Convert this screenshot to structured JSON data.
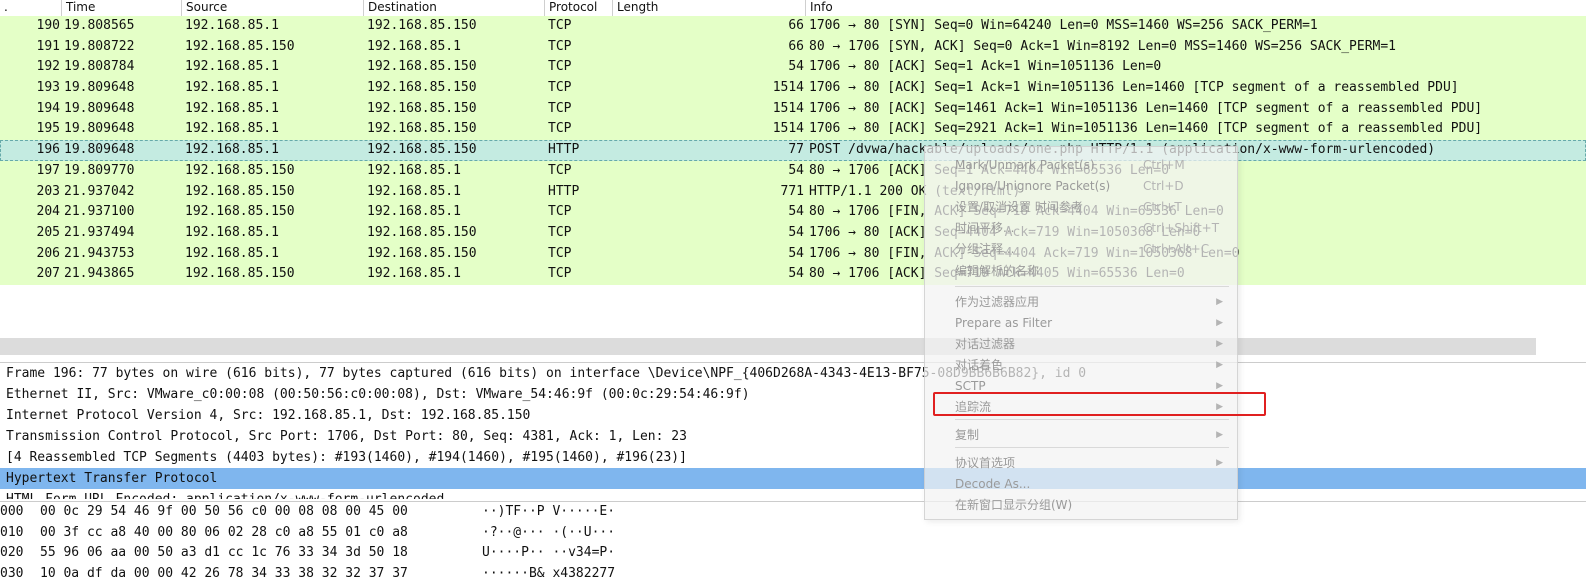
{
  "columns": {
    "mark": ".",
    "time": "Time",
    "source": "Source",
    "destination": "Destination",
    "protocol": "Protocol",
    "length": "Length",
    "info": "Info"
  },
  "packets": [
    {
      "no": "190",
      "time": "19.808565",
      "src": "192.168.85.1",
      "dst": "192.168.85.150",
      "proto": "TCP",
      "len": "66",
      "info": "1706 → 80 [SYN] Seq=0 Win=64240 Len=0 MSS=1460 WS=256 SACK_PERM=1"
    },
    {
      "no": "191",
      "time": "19.808722",
      "src": "192.168.85.150",
      "dst": "192.168.85.1",
      "proto": "TCP",
      "len": "66",
      "info": "80 → 1706 [SYN, ACK] Seq=0 Ack=1 Win=8192 Len=0 MSS=1460 WS=256 SACK_PERM=1"
    },
    {
      "no": "192",
      "time": "19.808784",
      "src": "192.168.85.1",
      "dst": "192.168.85.150",
      "proto": "TCP",
      "len": "54",
      "info": "1706 → 80 [ACK] Seq=1 Ack=1 Win=1051136 Len=0"
    },
    {
      "no": "193",
      "time": "19.809648",
      "src": "192.168.85.1",
      "dst": "192.168.85.150",
      "proto": "TCP",
      "len": "1514",
      "info": "1706 → 80 [ACK] Seq=1 Ack=1 Win=1051136 Len=1460 [TCP segment of a reassembled PDU]"
    },
    {
      "no": "194",
      "time": "19.809648",
      "src": "192.168.85.1",
      "dst": "192.168.85.150",
      "proto": "TCP",
      "len": "1514",
      "info": "1706 → 80 [ACK] Seq=1461 Ack=1 Win=1051136 Len=1460 [TCP segment of a reassembled PDU]"
    },
    {
      "no": "195",
      "time": "19.809648",
      "src": "192.168.85.1",
      "dst": "192.168.85.150",
      "proto": "TCP",
      "len": "1514",
      "info": "1706 → 80 [ACK] Seq=2921 Ack=1 Win=1051136 Len=1460 [TCP segment of a reassembled PDU]"
    },
    {
      "no": "196",
      "time": "19.809648",
      "src": "192.168.85.1",
      "dst": "192.168.85.150",
      "proto": "HTTP",
      "len": "77",
      "info": "POST /dvwa/hackable/uploads/one.php HTTP/1.1  (application/x-www-form-urlencoded)"
    },
    {
      "no": "197",
      "time": "19.809770",
      "src": "192.168.85.150",
      "dst": "192.168.85.1",
      "proto": "TCP",
      "len": "54",
      "info": "80 → 1706 [ACK] Seq=1 Ack=4404 Win=65536 Len=0"
    },
    {
      "no": "203",
      "time": "21.937042",
      "src": "192.168.85.150",
      "dst": "192.168.85.1",
      "proto": "HTTP",
      "len": "771",
      "info": "HTTP/1.1 200 OK  (text/html)"
    },
    {
      "no": "204",
      "time": "21.937100",
      "src": "192.168.85.150",
      "dst": "192.168.85.1",
      "proto": "TCP",
      "len": "54",
      "info": "80 → 1706 [FIN, ACK] Seq=718 Ack=4404 Win=65536 Len=0"
    },
    {
      "no": "205",
      "time": "21.937494",
      "src": "192.168.85.1",
      "dst": "192.168.85.150",
      "proto": "TCP",
      "len": "54",
      "info": "1706 → 80 [ACK] Seq=4404 Ack=719 Win=1050368 Len=0"
    },
    {
      "no": "206",
      "time": "21.943753",
      "src": "192.168.85.1",
      "dst": "192.168.85.150",
      "proto": "TCP",
      "len": "54",
      "info": "1706 → 80 [FIN, ACK] Seq=4404 Ack=719 Win=1050368 Len=0"
    },
    {
      "no": "207",
      "time": "21.943865",
      "src": "192.168.85.150",
      "dst": "192.168.85.1",
      "proto": "TCP",
      "len": "54",
      "info": "80 → 1706 [ACK] Seq=719 Ack=4405 Win=65536 Len=0"
    }
  ],
  "selected_packet_index": 6,
  "details": [
    "Frame 196: 77 bytes on wire (616 bits), 77 bytes captured (616 bits) on interface \\Device\\NPF_{406D268A-4343-4E13-BF75-08D9BB6B6B82}, id 0",
    "Ethernet II, Src: VMware_c0:00:08 (00:50:56:c0:00:08), Dst: VMware_54:46:9f (00:0c:29:54:46:9f)",
    "Internet Protocol Version 4, Src: 192.168.85.1, Dst: 192.168.85.150",
    "Transmission Control Protocol, Src Port: 1706, Dst Port: 80, Seq: 4381, Ack: 1, Len: 23",
    "[4 Reassembled TCP Segments (4403 bytes): #193(1460), #194(1460), #195(1460), #196(23)]",
    "Hypertext Transfer Protocol",
    "HTML Form URL Encoded: application/x-www-form-urlencoded"
  ],
  "selected_detail_index": 5,
  "bytes": [
    {
      "offset": "000",
      "hex": "00 0c 29 54 46 9f 00 50  56 c0 00 08 08 00 45 00",
      "ascii": "··)TF··P V·····E·"
    },
    {
      "offset": "010",
      "hex": "00 3f cc a8 40 00 80 06  02 28 c0 a8 55 01 c0 a8",
      "ascii": "·?··@··· ·(··U···"
    },
    {
      "offset": "020",
      "hex": "55 96 06 aa 00 50 a3 d1  cc 1c 76 33 34 3d 50 18",
      "ascii": "U····P·· ··v34=P·"
    },
    {
      "offset": "030",
      "hex": "10 0a df da 00 00 42 26  78 34 33 38 32 32 37 37",
      "ascii": "······B& x4382277"
    }
  ],
  "context_menu": {
    "items": [
      {
        "label": "Mark/Unmark Packet(s)",
        "shortcut": "Ctrl+M",
        "submenu": false
      },
      {
        "label": "Ignore/Unignore Packet(s)",
        "shortcut": "Ctrl+D",
        "submenu": false
      },
      {
        "label": "设置/取消设置 时间参考",
        "shortcut": "Ctrl+T",
        "submenu": false
      },
      {
        "label": "时间平移...",
        "shortcut": "Ctrl+Shift+T",
        "submenu": false
      },
      {
        "label": "分组注释...",
        "shortcut": "Ctrl+Alt+C",
        "submenu": false
      },
      {
        "label": "编辑解析的名称",
        "shortcut": "",
        "submenu": false
      },
      {
        "label": "作为过滤器应用",
        "shortcut": "",
        "submenu": true
      },
      {
        "label": "Prepare as Filter",
        "shortcut": "",
        "submenu": true
      },
      {
        "label": "对话过滤器",
        "shortcut": "",
        "submenu": true
      },
      {
        "label": "对话着色",
        "shortcut": "",
        "submenu": true
      },
      {
        "label": "SCTP",
        "shortcut": "",
        "submenu": true
      },
      {
        "label": "追踪流",
        "shortcut": "",
        "submenu": true
      },
      {
        "label": "复制",
        "shortcut": "",
        "submenu": true
      },
      {
        "label": "协议首选项",
        "shortcut": "",
        "submenu": true
      },
      {
        "label": "Decode As...",
        "shortcut": "",
        "submenu": false
      },
      {
        "label": "在新窗口显示分组(W)",
        "shortcut": "",
        "submenu": false
      }
    ],
    "highlighted_label": "追踪流"
  },
  "colors": {
    "row_green": "#e4ffc7",
    "selected_row": "#c4ebe1",
    "detail_selected": "#7fb6ee",
    "highlight_box": "#e02020"
  }
}
